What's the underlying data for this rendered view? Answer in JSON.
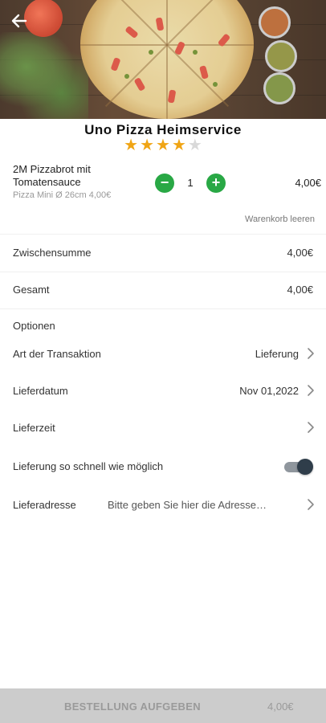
{
  "store": {
    "name": "Uno Pizza Heimservice",
    "rating": 4,
    "rating_max": 5
  },
  "cart": {
    "items": [
      {
        "name": "2M Pizzabrot mit Tomatensauce",
        "sub": "Pizza Mini Ø 26cm 4,00€",
        "quantity": "1",
        "price": "4,00€",
        "minus_icon": "minus-icon",
        "plus_icon": "plus-icon"
      }
    ],
    "clear_label": "Warenkorb leeren"
  },
  "totals": {
    "subtotal_label": "Zwischensumme",
    "subtotal_value": "4,00€",
    "total_label": "Gesamt",
    "total_value": "4,00€"
  },
  "options": {
    "section_label": "Optionen",
    "transaction_label": "Art der Transaktion",
    "transaction_value": "Lieferung",
    "date_label": "Lieferdatum",
    "date_value": "Nov 01,2022",
    "time_label": "Lieferzeit",
    "time_value": "",
    "asap_label": "Lieferung so schnell wie möglich",
    "asap_enabled": true,
    "address_label": "Lieferadresse",
    "address_placeholder": "Bitte geben Sie hier die Adresse ein"
  },
  "order": {
    "button_label": "BESTELLUNG AUFGEBEN",
    "total": "4,00€"
  },
  "colors": {
    "accent_green": "#29a845",
    "star_gold": "#f0a515",
    "toggle_knob": "#2f3d4a",
    "order_bar": "#cccccc"
  }
}
